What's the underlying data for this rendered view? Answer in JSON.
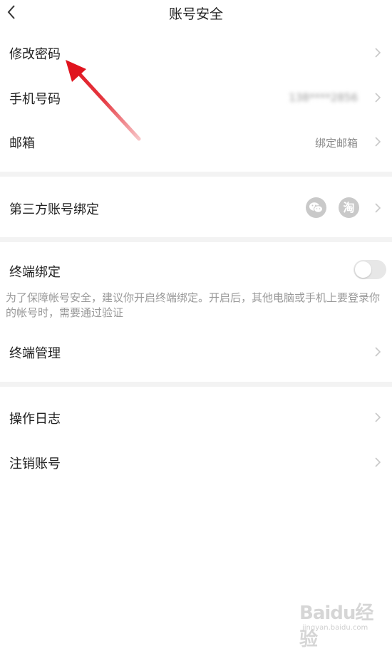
{
  "header": {
    "title": "账号安全"
  },
  "account": {
    "change_password": {
      "label": "修改密码"
    },
    "phone": {
      "label": "手机号码",
      "value": "138****2856"
    },
    "email": {
      "label": "邮箱",
      "value": "绑定邮箱"
    }
  },
  "third_party": {
    "label": "第三方账号绑定",
    "icons": [
      "wechat-icon",
      "taobao-icon"
    ],
    "taobao_glyph": "淘"
  },
  "terminal_binding": {
    "label": "终端绑定",
    "toggle_on": false,
    "description": "为了保障帐号安全，建议你开启终端绑定。开启后，其他电脑或手机上要登录你的帐号时，需要通过验证"
  },
  "terminal_management": {
    "label": "终端管理"
  },
  "operation_log": {
    "label": "操作日志"
  },
  "cancel_account": {
    "label": "注销账号"
  },
  "annotation": {
    "arrow_color": "#e0141e"
  },
  "watermark": {
    "text": "Baidu经验",
    "sub": "jingyan.baidu.com"
  }
}
